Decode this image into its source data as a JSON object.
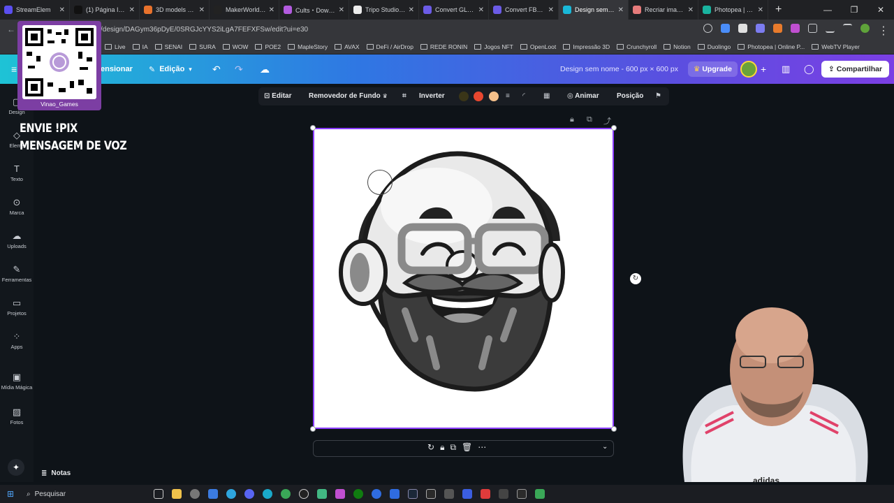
{
  "browser": {
    "tabs": [
      {
        "label": "StreamElem",
        "color": "#5b4ff0"
      },
      {
        "label": "(1) Página Inici",
        "color": "#111111"
      },
      {
        "label": "3D models dat",
        "color": "#e8722c"
      },
      {
        "label": "MakerWorld: 3",
        "color": "#222222"
      },
      {
        "label": "Cults・Downlo",
        "color": "#b35be0"
      },
      {
        "label": "Tripo Studio | 0",
        "color": "#ececec"
      },
      {
        "label": "Convert GLB to",
        "color": "#6b5be6"
      },
      {
        "label": "Convert FBX to",
        "color": "#6b5be6"
      },
      {
        "label": "Design sem no",
        "color": "#19b8d8",
        "active": true
      },
      {
        "label": "Recriar imagem",
        "color": "#e67b7b"
      },
      {
        "label": "Photopea | Onl",
        "color": "#19b39f"
      }
    ],
    "url": "/design/DAGym36pDyE/0SRGJcYYS2iLgA7FEFXFSw/edit?ui=e30",
    "bookmarks": [
      "Live",
      "IA",
      "SENAI",
      "SURA",
      "WOW",
      "POE2",
      "MapleStory",
      "AVAX",
      "DeFi / AirDrop",
      "REDE RONIN",
      "Jogos NFT",
      "OpenLoot",
      "Impressão 3D",
      "Crunchyroll",
      "Notion",
      "Duolingo",
      "Photopea | Online P...",
      "WebTV Player"
    ]
  },
  "header": {
    "resize": "ensionar",
    "edit": "Edição",
    "title": "Design sem nome - 600 px × 600 px",
    "upgrade": "Upgrade",
    "share": "Compartilhar"
  },
  "sidebar": {
    "items": [
      {
        "label": "Design",
        "icon": "▢"
      },
      {
        "label": "Eleme",
        "icon": "◇"
      },
      {
        "label": "Texto",
        "icon": "T"
      },
      {
        "label": "Marca",
        "icon": "⊙"
      },
      {
        "label": "Uploads",
        "icon": "☁"
      },
      {
        "label": "Ferramentas",
        "icon": "✎"
      },
      {
        "label": "Projetos",
        "icon": "▭"
      },
      {
        "label": "Apps",
        "icon": "⁘"
      },
      {
        "label": "Mídia Mágica",
        "icon": "▣"
      },
      {
        "label": "Fotos",
        "icon": "▨"
      }
    ]
  },
  "overlay": {
    "qr_name": "Vinao_Games",
    "line1": "ENVIE !PIX",
    "line2": "MENSAGEM DE VOZ"
  },
  "toolbar": {
    "edit": "Editar",
    "bg_remover": "Removedor de Fundo",
    "invert": "Inverter",
    "animate": "Animar",
    "position": "Posição",
    "colors": [
      "#3a3518",
      "#e8472f",
      "#f5c08a"
    ]
  },
  "footer": {
    "notes": "Notas"
  },
  "taskbar": {
    "search": "Pesquisar"
  }
}
